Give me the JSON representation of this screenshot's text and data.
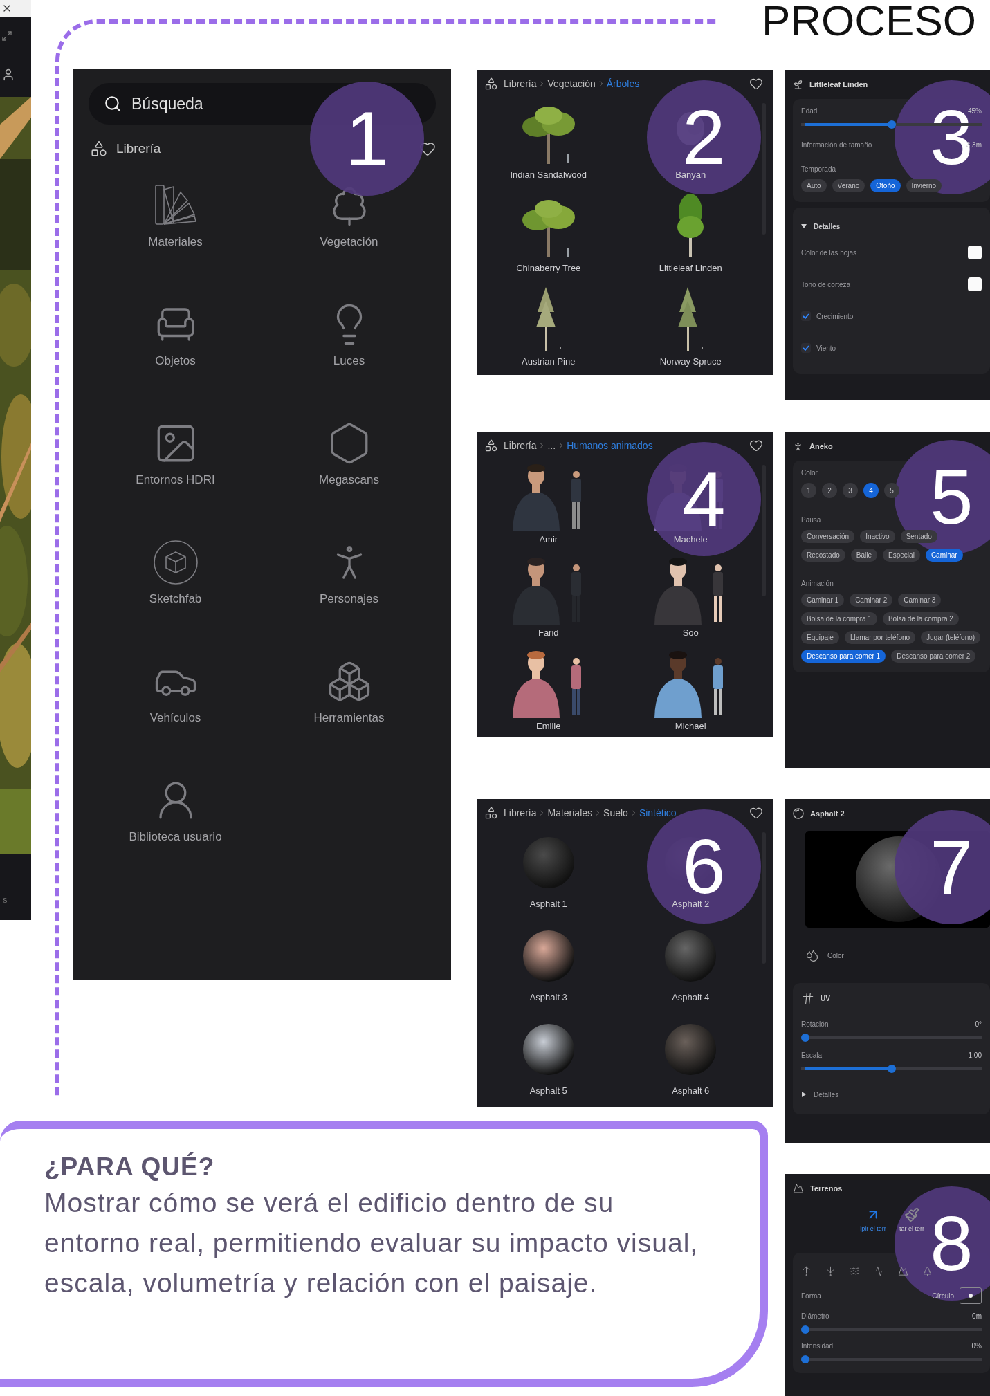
{
  "heading": "PROCESO",
  "side_strip": {
    "caption": "s"
  },
  "library_home": {
    "badge": "1",
    "search": {
      "placeholder": "Búsqueda"
    },
    "title": "Librería",
    "categories": [
      "Materiales",
      "Vegetación",
      "Objetos",
      "Luces",
      "Entornos HDRI",
      "Megascans",
      "Sketchfab",
      "Personajes",
      "Vehículos",
      "Herramientas",
      "Biblioteca usuario"
    ]
  },
  "trees_library": {
    "badge": "2",
    "breadcrumb": [
      "Librería",
      "Vegetación",
      "Árboles"
    ],
    "items": [
      "Indian Sandalwood",
      "Banyan",
      "Chinaberry Tree",
      "Littleleaf Linden",
      "Austrian Pine",
      "Norway Spruce"
    ]
  },
  "tree_properties": {
    "badge": "3",
    "title": "Littleleaf Linden",
    "age": {
      "label": "Edad",
      "value": "45%",
      "level": 0.5
    },
    "size": {
      "label": "Información de tamaño",
      "value": "3,3m"
    },
    "season": {
      "label": "Temporada",
      "options": [
        {
          "label": "Auto",
          "selected": false
        },
        {
          "label": "Verano",
          "selected": false
        },
        {
          "label": "Otoño",
          "selected": true
        },
        {
          "label": "Invierno",
          "selected": false
        }
      ]
    },
    "details": {
      "label": "Detalles",
      "expanded": true,
      "rows": [
        {
          "kind": "swatch",
          "label": "Color de las hojas"
        },
        {
          "kind": "swatch",
          "label": "Tono de corteza"
        },
        {
          "kind": "checkbox",
          "label": "Crecimiento",
          "checked": true
        },
        {
          "kind": "checkbox",
          "label": "Viento",
          "checked": true
        }
      ]
    }
  },
  "humans_library": {
    "badge": "4",
    "breadcrumb": [
      "Librería",
      "...",
      "Humanos animados"
    ],
    "items": [
      "Amir",
      "Machele",
      "Farid",
      "Soo",
      "Emilie",
      "Michael"
    ]
  },
  "human_properties": {
    "badge": "5",
    "title": "Aneko",
    "groups": [
      {
        "label": "Color",
        "kind": "numbers",
        "options": [
          {
            "label": "1",
            "selected": false
          },
          {
            "label": "2",
            "selected": false
          },
          {
            "label": "3",
            "selected": false
          },
          {
            "label": "4",
            "selected": true
          },
          {
            "label": "5",
            "selected": false
          }
        ]
      },
      {
        "label": "Pausa",
        "kind": "tags",
        "options": [
          {
            "label": "Conversación",
            "selected": false
          },
          {
            "label": "Inactivo",
            "selected": false
          },
          {
            "label": "Sentado",
            "selected": false
          },
          {
            "label": "Recostado",
            "selected": false
          },
          {
            "label": "Baile",
            "selected": false
          },
          {
            "label": "Especial",
            "selected": false
          },
          {
            "label": "Caminar",
            "selected": true
          }
        ]
      },
      {
        "label": "Animación",
        "kind": "tags",
        "options": [
          {
            "label": "Caminar 1",
            "selected": false
          },
          {
            "label": "Caminar 2",
            "selected": false
          },
          {
            "label": "Caminar 3",
            "selected": false
          },
          {
            "label": "Bolsa de la compra 1",
            "selected": false
          },
          {
            "label": "Bolsa de la compra 2",
            "selected": false
          },
          {
            "label": "Equipaje",
            "selected": false
          },
          {
            "label": "Llamar por teléfono",
            "selected": false
          },
          {
            "label": "Jugar (teléfono)",
            "selected": false
          },
          {
            "label": "Descanso para comer 1",
            "selected": true
          },
          {
            "label": "Descanso para comer 2",
            "selected": false
          }
        ]
      }
    ]
  },
  "materials_library": {
    "badge": "6",
    "breadcrumb": [
      "Librería",
      "Materiales",
      "Suelo",
      "Sintético"
    ],
    "items": [
      "Asphalt 1",
      "Asphalt 2",
      "Asphalt 3",
      "Asphalt 4",
      "Asphalt 5",
      "Asphalt 6"
    ]
  },
  "material_properties": {
    "badge": "7",
    "title": "Asphalt 2",
    "color_label": "Color",
    "uv": {
      "label": "UV",
      "sliders": [
        {
          "label": "Rotación",
          "value": "0°",
          "level": 0
        },
        {
          "label": "Escala",
          "value": "1,00",
          "level": 0.5
        }
      ],
      "details": {
        "label": "Detalles",
        "expanded": false
      }
    }
  },
  "terrain": {
    "badge": "8",
    "title": "Terrenos",
    "modes": [
      {
        "label": "lpir el terr",
        "selected": true
      },
      {
        "label": "tar el terr",
        "selected": false
      }
    ],
    "shape": {
      "label": "Forma",
      "value": "Círculo"
    },
    "sliders": [
      {
        "label": "Diámetro",
        "value": "0m",
        "level": 0
      },
      {
        "label": "Intensidad",
        "value": "0%",
        "level": 0
      }
    ]
  },
  "purpose": {
    "title": "¿PARA QUÉ?",
    "text": "Mostrar cómo se verá el edificio dentro de su entorno real, permitiendo evaluar su impacto visual, escala, volumetría y relación con el paisaje."
  }
}
